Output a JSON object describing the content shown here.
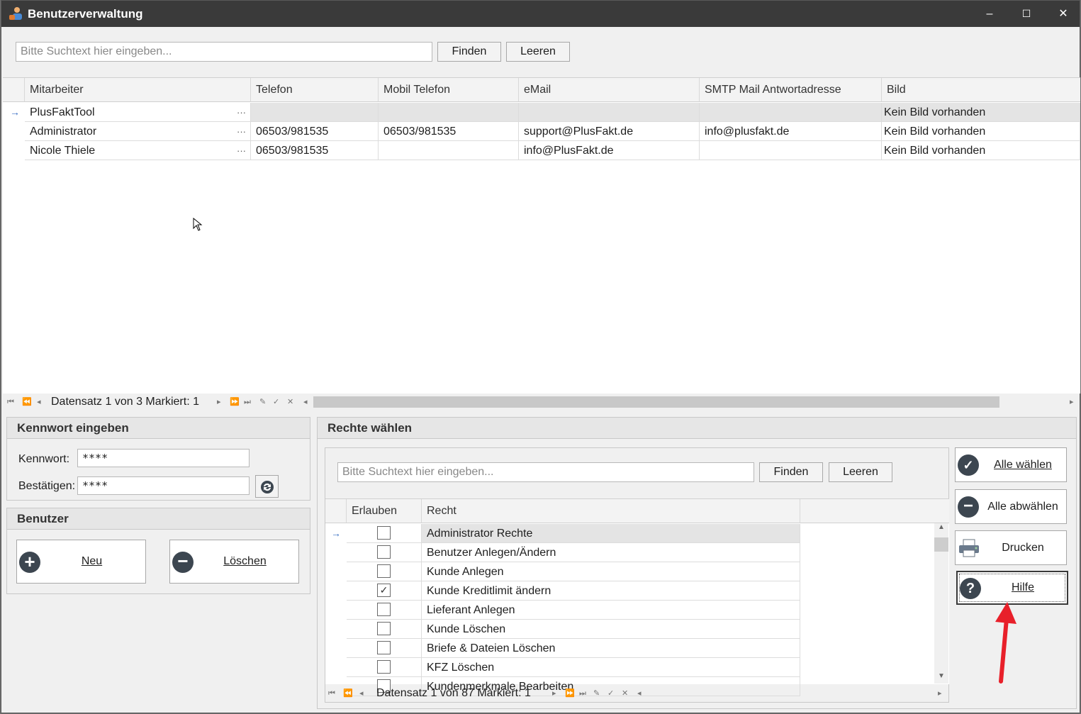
{
  "window": {
    "title": "Benutzerverwaltung",
    "minimize": "–",
    "maximize": "☐",
    "close": "✕"
  },
  "search_top": {
    "placeholder": "Bitte Suchtext hier eingeben...",
    "find_label": "Finden",
    "clear_label": "Leeren"
  },
  "user_grid": {
    "columns": [
      "Mitarbeiter",
      "Telefon",
      "Mobil Telefon",
      "eMail",
      "SMTP Mail Antwortadresse",
      "Bild"
    ],
    "rows": [
      {
        "mitarbeiter": "PlusFaktTool",
        "telefon": "",
        "mobil": "",
        "email": "",
        "smtp": "",
        "bild": "Kein Bild vorhanden"
      },
      {
        "mitarbeiter": "Administrator",
        "telefon": "06503/981535",
        "mobil": "06503/981535",
        "email": "support@PlusFakt.de",
        "smtp": "info@plusfakt.de",
        "bild": "Kein Bild vorhanden"
      },
      {
        "mitarbeiter": "Nicole Thiele",
        "telefon": "06503/981535",
        "mobil": "",
        "email": "info@PlusFakt.de",
        "smtp": "",
        "bild": "Kein Bild vorhanden"
      }
    ],
    "ellipsis": "···",
    "row_indicator": "→",
    "nav_text": "Datensatz 1 von 3 Markiert: 1"
  },
  "password_panel": {
    "title": "Kennwort eingeben",
    "password_label": "Kennwort:",
    "password_value": "****",
    "confirm_label": "Bestätigen:",
    "confirm_value": "****"
  },
  "user_panel": {
    "title": "Benutzer",
    "new_label": "Neu",
    "delete_label": "Löschen"
  },
  "rights_panel": {
    "title": "Rechte wählen",
    "search_placeholder": "Bitte Suchtext hier eingeben...",
    "find_label": "Finden",
    "clear_label": "Leeren",
    "columns": [
      "Erlauben",
      "Recht"
    ],
    "rows": [
      {
        "allowed": false,
        "right": "Administrator Rechte"
      },
      {
        "allowed": false,
        "right": "Benutzer Anlegen/Ändern"
      },
      {
        "allowed": false,
        "right": "Kunde Anlegen"
      },
      {
        "allowed": true,
        "right": "Kunde Kreditlimit ändern"
      },
      {
        "allowed": false,
        "right": "Lieferant Anlegen"
      },
      {
        "allowed": false,
        "right": "Kunde Löschen"
      },
      {
        "allowed": false,
        "right": "Briefe & Dateien Löschen"
      },
      {
        "allowed": false,
        "right": "KFZ Löschen"
      },
      {
        "allowed": false,
        "right": "Kundenmerkmale Bearbeiten"
      }
    ],
    "nav_text": "Datensatz 1 von 87 Markiert: 1"
  },
  "side_buttons": {
    "select_all": "Alle wählen",
    "deselect_all": "Alle abwählen",
    "print": "Drucken",
    "help": "Hilfe"
  },
  "colors": {
    "titlebar": "#3a3a3a",
    "selected_row": "#e4e4e4",
    "annotation_arrow": "#e8202a"
  }
}
